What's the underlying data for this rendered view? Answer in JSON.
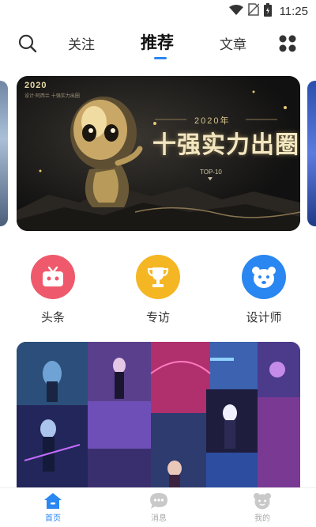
{
  "status_bar": {
    "time": "11:25"
  },
  "top_nav": {
    "tabs": [
      {
        "label": "关注"
      },
      {
        "label": "推荐"
      },
      {
        "label": "文章"
      }
    ]
  },
  "banner": {
    "badge_year": "2020",
    "badge_subtitle": "设计·阿西兰 十强实力出圈",
    "year_text": "2020年",
    "title": "十强实力出圈",
    "top_text": "TOP-10"
  },
  "categories": [
    {
      "label": "头条",
      "icon": "tv-icon",
      "color": "#ee5a6b"
    },
    {
      "label": "专访",
      "icon": "trophy-icon",
      "color": "#f5b623"
    },
    {
      "label": "设计师",
      "icon": "bear-face-icon",
      "color": "#2a86f0"
    }
  ],
  "bottom_bar": {
    "items": [
      {
        "label": "首页",
        "icon": "home-icon"
      },
      {
        "label": "消息",
        "icon": "chat-icon"
      },
      {
        "label": "我的",
        "icon": "profile-icon"
      }
    ],
    "active_color": "#2a86f0"
  }
}
